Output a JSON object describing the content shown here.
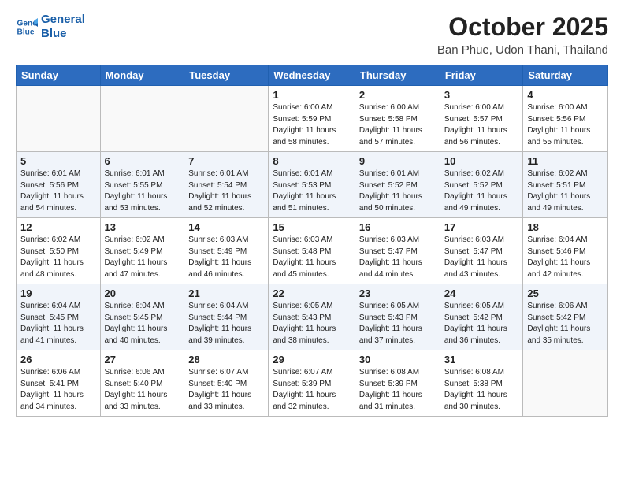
{
  "logo": {
    "line1": "General",
    "line2": "Blue"
  },
  "title": "October 2025",
  "location": "Ban Phue, Udon Thani, Thailand",
  "weekdays": [
    "Sunday",
    "Monday",
    "Tuesday",
    "Wednesday",
    "Thursday",
    "Friday",
    "Saturday"
  ],
  "weeks": [
    [
      {
        "day": "",
        "info": ""
      },
      {
        "day": "",
        "info": ""
      },
      {
        "day": "",
        "info": ""
      },
      {
        "day": "1",
        "info": "Sunrise: 6:00 AM\nSunset: 5:59 PM\nDaylight: 11 hours\nand 58 minutes."
      },
      {
        "day": "2",
        "info": "Sunrise: 6:00 AM\nSunset: 5:58 PM\nDaylight: 11 hours\nand 57 minutes."
      },
      {
        "day": "3",
        "info": "Sunrise: 6:00 AM\nSunset: 5:57 PM\nDaylight: 11 hours\nand 56 minutes."
      },
      {
        "day": "4",
        "info": "Sunrise: 6:00 AM\nSunset: 5:56 PM\nDaylight: 11 hours\nand 55 minutes."
      }
    ],
    [
      {
        "day": "5",
        "info": "Sunrise: 6:01 AM\nSunset: 5:56 PM\nDaylight: 11 hours\nand 54 minutes."
      },
      {
        "day": "6",
        "info": "Sunrise: 6:01 AM\nSunset: 5:55 PM\nDaylight: 11 hours\nand 53 minutes."
      },
      {
        "day": "7",
        "info": "Sunrise: 6:01 AM\nSunset: 5:54 PM\nDaylight: 11 hours\nand 52 minutes."
      },
      {
        "day": "8",
        "info": "Sunrise: 6:01 AM\nSunset: 5:53 PM\nDaylight: 11 hours\nand 51 minutes."
      },
      {
        "day": "9",
        "info": "Sunrise: 6:01 AM\nSunset: 5:52 PM\nDaylight: 11 hours\nand 50 minutes."
      },
      {
        "day": "10",
        "info": "Sunrise: 6:02 AM\nSunset: 5:52 PM\nDaylight: 11 hours\nand 49 minutes."
      },
      {
        "day": "11",
        "info": "Sunrise: 6:02 AM\nSunset: 5:51 PM\nDaylight: 11 hours\nand 49 minutes."
      }
    ],
    [
      {
        "day": "12",
        "info": "Sunrise: 6:02 AM\nSunset: 5:50 PM\nDaylight: 11 hours\nand 48 minutes."
      },
      {
        "day": "13",
        "info": "Sunrise: 6:02 AM\nSunset: 5:49 PM\nDaylight: 11 hours\nand 47 minutes."
      },
      {
        "day": "14",
        "info": "Sunrise: 6:03 AM\nSunset: 5:49 PM\nDaylight: 11 hours\nand 46 minutes."
      },
      {
        "day": "15",
        "info": "Sunrise: 6:03 AM\nSunset: 5:48 PM\nDaylight: 11 hours\nand 45 minutes."
      },
      {
        "day": "16",
        "info": "Sunrise: 6:03 AM\nSunset: 5:47 PM\nDaylight: 11 hours\nand 44 minutes."
      },
      {
        "day": "17",
        "info": "Sunrise: 6:03 AM\nSunset: 5:47 PM\nDaylight: 11 hours\nand 43 minutes."
      },
      {
        "day": "18",
        "info": "Sunrise: 6:04 AM\nSunset: 5:46 PM\nDaylight: 11 hours\nand 42 minutes."
      }
    ],
    [
      {
        "day": "19",
        "info": "Sunrise: 6:04 AM\nSunset: 5:45 PM\nDaylight: 11 hours\nand 41 minutes."
      },
      {
        "day": "20",
        "info": "Sunrise: 6:04 AM\nSunset: 5:45 PM\nDaylight: 11 hours\nand 40 minutes."
      },
      {
        "day": "21",
        "info": "Sunrise: 6:04 AM\nSunset: 5:44 PM\nDaylight: 11 hours\nand 39 minutes."
      },
      {
        "day": "22",
        "info": "Sunrise: 6:05 AM\nSunset: 5:43 PM\nDaylight: 11 hours\nand 38 minutes."
      },
      {
        "day": "23",
        "info": "Sunrise: 6:05 AM\nSunset: 5:43 PM\nDaylight: 11 hours\nand 37 minutes."
      },
      {
        "day": "24",
        "info": "Sunrise: 6:05 AM\nSunset: 5:42 PM\nDaylight: 11 hours\nand 36 minutes."
      },
      {
        "day": "25",
        "info": "Sunrise: 6:06 AM\nSunset: 5:42 PM\nDaylight: 11 hours\nand 35 minutes."
      }
    ],
    [
      {
        "day": "26",
        "info": "Sunrise: 6:06 AM\nSunset: 5:41 PM\nDaylight: 11 hours\nand 34 minutes."
      },
      {
        "day": "27",
        "info": "Sunrise: 6:06 AM\nSunset: 5:40 PM\nDaylight: 11 hours\nand 33 minutes."
      },
      {
        "day": "28",
        "info": "Sunrise: 6:07 AM\nSunset: 5:40 PM\nDaylight: 11 hours\nand 33 minutes."
      },
      {
        "day": "29",
        "info": "Sunrise: 6:07 AM\nSunset: 5:39 PM\nDaylight: 11 hours\nand 32 minutes."
      },
      {
        "day": "30",
        "info": "Sunrise: 6:08 AM\nSunset: 5:39 PM\nDaylight: 11 hours\nand 31 minutes."
      },
      {
        "day": "31",
        "info": "Sunrise: 6:08 AM\nSunset: 5:38 PM\nDaylight: 11 hours\nand 30 minutes."
      },
      {
        "day": "",
        "info": ""
      }
    ]
  ]
}
